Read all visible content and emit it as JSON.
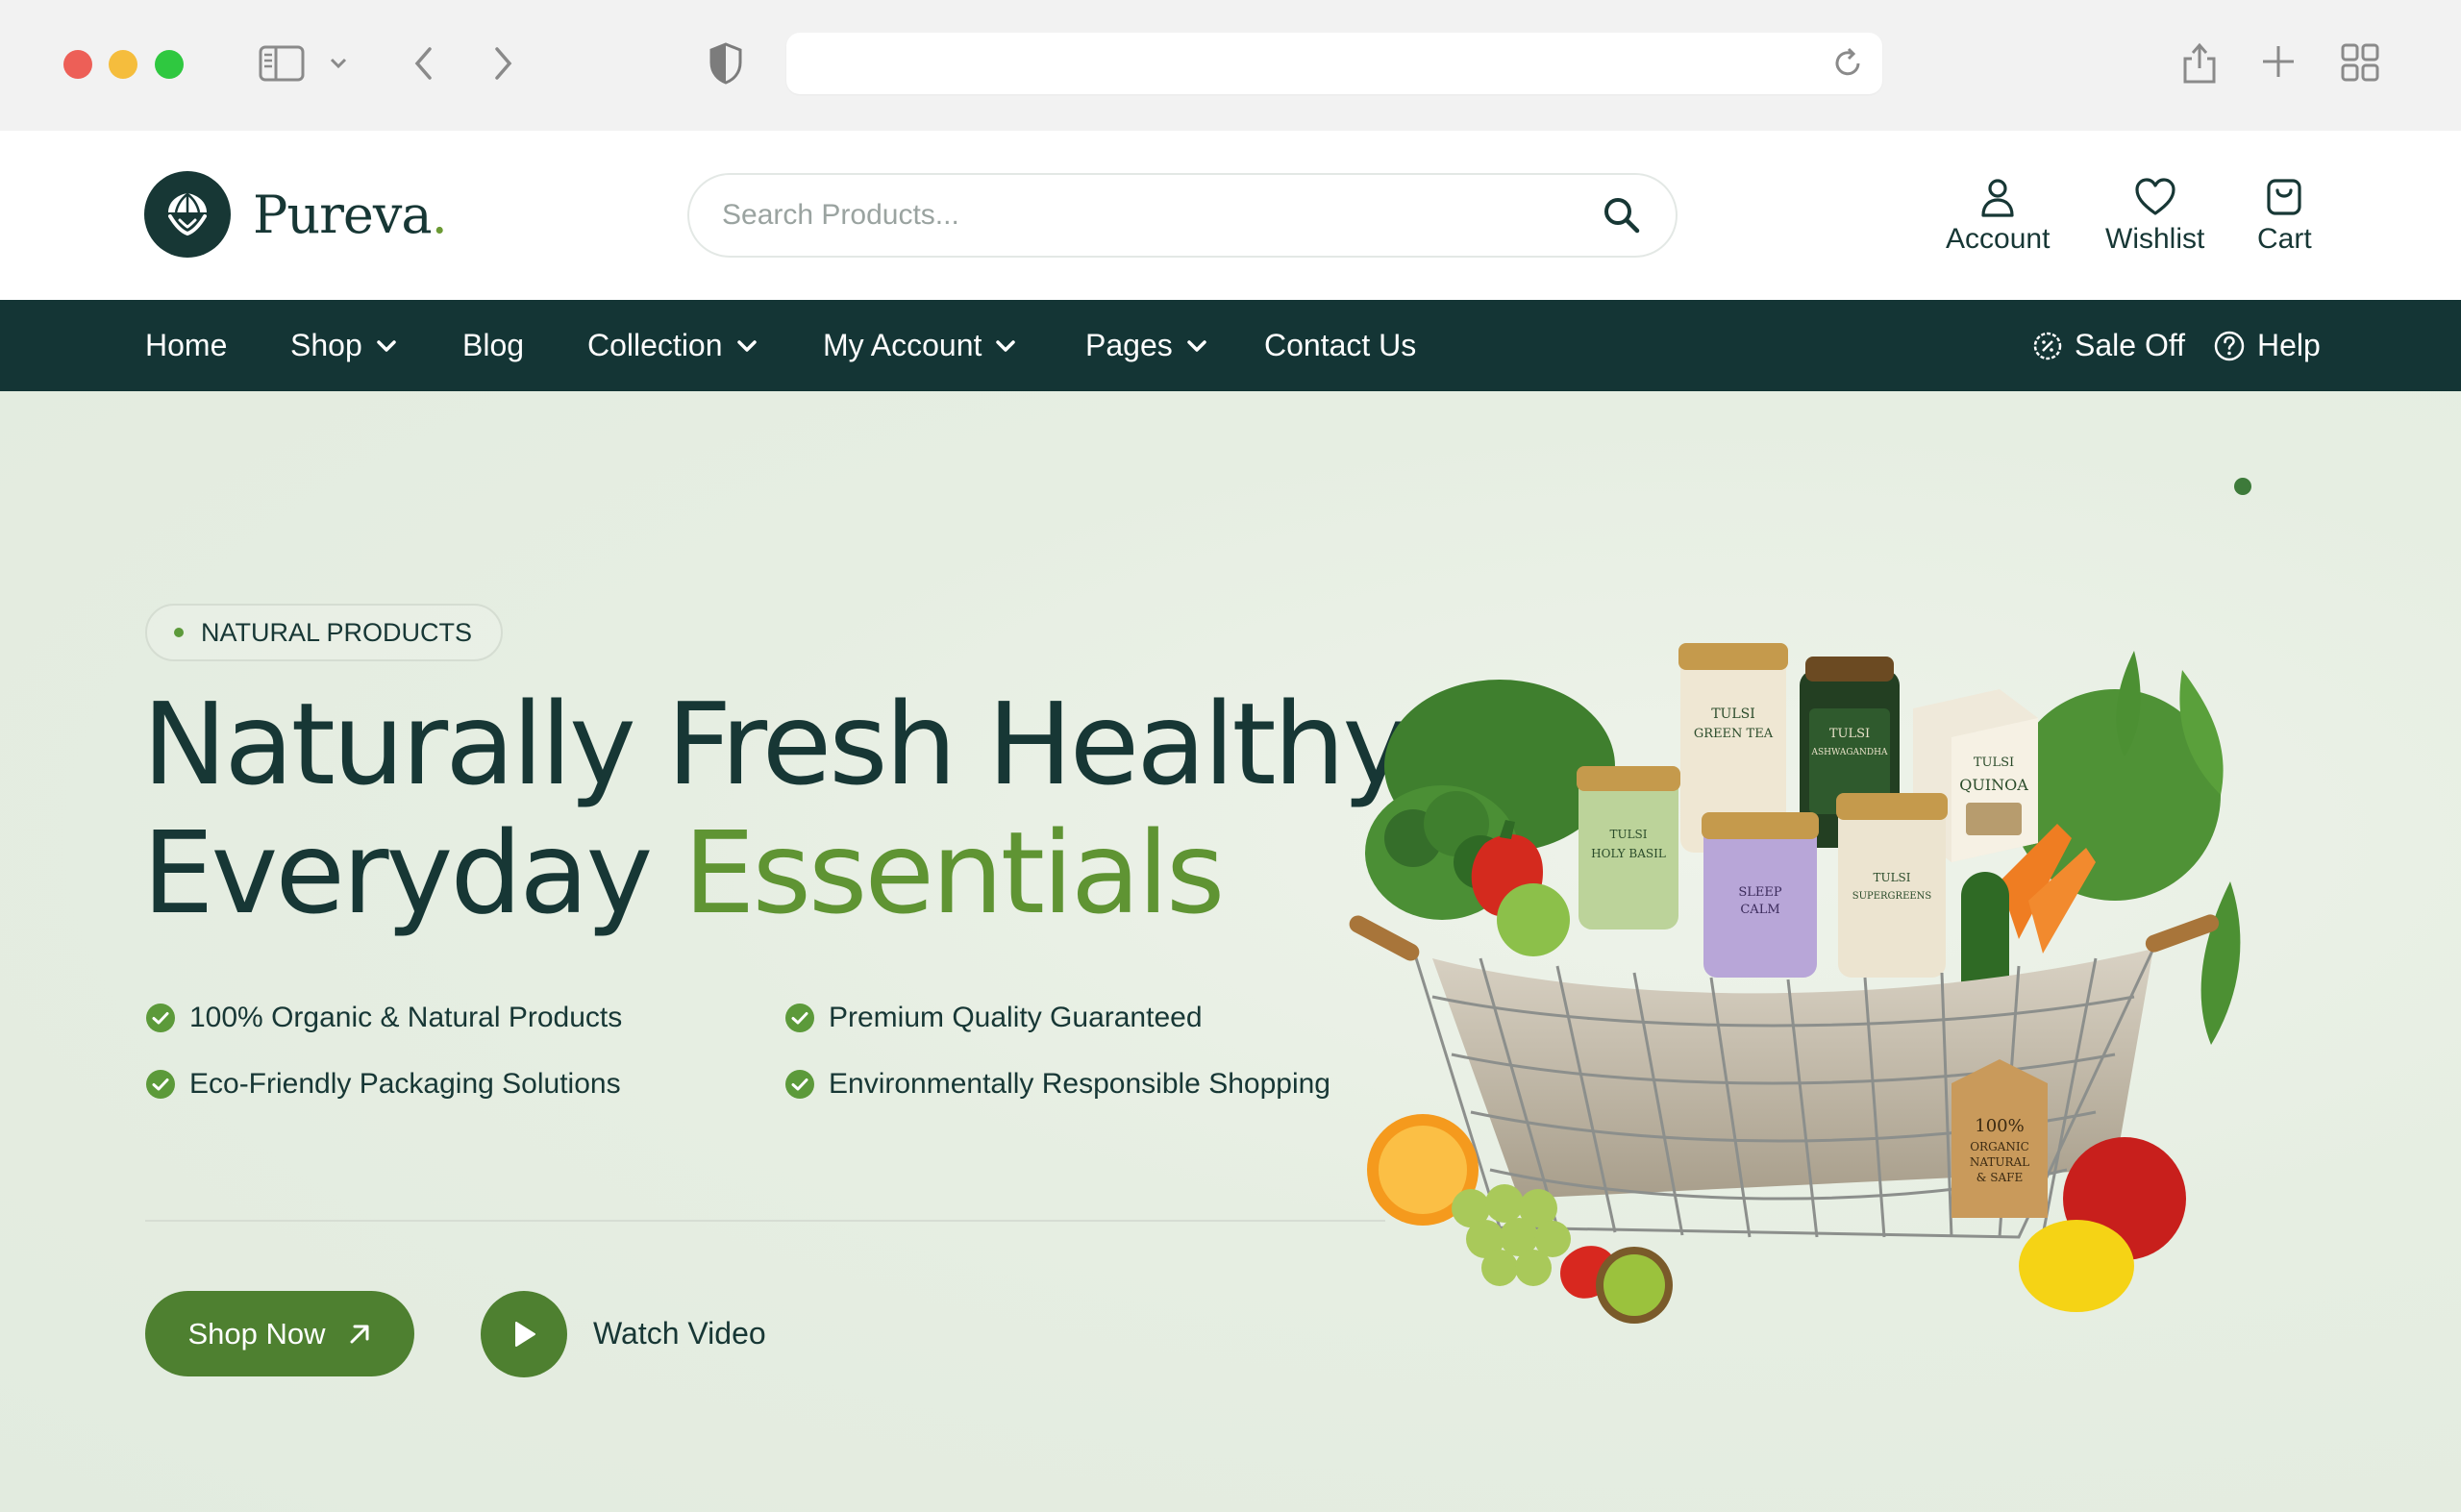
{
  "browser": {
    "url": "",
    "icons": [
      "sidebar-icon",
      "chevron-down-icon",
      "back-icon",
      "forward-icon",
      "shield-icon",
      "reload-icon",
      "share-icon",
      "new-tab-icon",
      "tab-overview-icon"
    ]
  },
  "header": {
    "brand_name": "Pureva",
    "brand_dot": ".",
    "search_placeholder": "Search Products...",
    "actions": [
      {
        "label": "Account",
        "icon": "user-icon"
      },
      {
        "label": "Wishlist",
        "icon": "heart-icon"
      },
      {
        "label": "Cart",
        "icon": "bag-icon"
      }
    ]
  },
  "nav": {
    "items": [
      {
        "label": "Home",
        "dropdown": false
      },
      {
        "label": "Shop",
        "dropdown": true
      },
      {
        "label": "Blog",
        "dropdown": false
      },
      {
        "label": "Collection",
        "dropdown": true
      },
      {
        "label": "My Account",
        "dropdown": true
      },
      {
        "label": "Pages",
        "dropdown": true
      },
      {
        "label": "Contact Us",
        "dropdown": false
      }
    ],
    "sale_label": "Sale Off",
    "help_label": "Help"
  },
  "hero": {
    "badge": "NATURAL PRODUCTS",
    "headline_line1": "Naturally Fresh Healthy",
    "headline_line2_a": "Everyday ",
    "headline_line2_b": "Essentials",
    "features": [
      "100% Organic & Natural Products",
      "Premium Quality Guaranteed",
      "Eco-Friendly Packaging Solutions",
      "Environmentally Responsible Shopping"
    ],
    "shop_button": "Shop Now",
    "watch_label": "Watch Video",
    "jar_labels": [
      "TULSI",
      "GREEN TEA",
      "TULSI",
      "ASHWAGANDHA",
      "TULSI",
      "QUINOA",
      "TULSI",
      "HOLY BASIL",
      "SLEEP",
      "CALM",
      "TULSI",
      "SUPERGREENS"
    ],
    "tag_lines": [
      "100%",
      "ORGANIC",
      "NATURAL",
      "& SAFE"
    ]
  },
  "colors": {
    "brand_dark": "#143535",
    "brand_green": "#4e8030",
    "accent_green": "#5f9433"
  }
}
